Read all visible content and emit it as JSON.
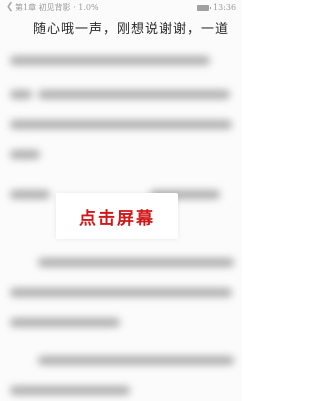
{
  "status_bar": {
    "chapter_progress": "第1章 初见背影 · 1.0%",
    "time": "13:36"
  },
  "reader": {
    "first_line": "随心哦一声，刚想说谢谢，一道"
  },
  "overlay": {
    "tap_label": "点击屏幕"
  },
  "colors": {
    "accent": "#d01818",
    "text": "#2a2a2a",
    "muted": "#9a9a9a"
  }
}
